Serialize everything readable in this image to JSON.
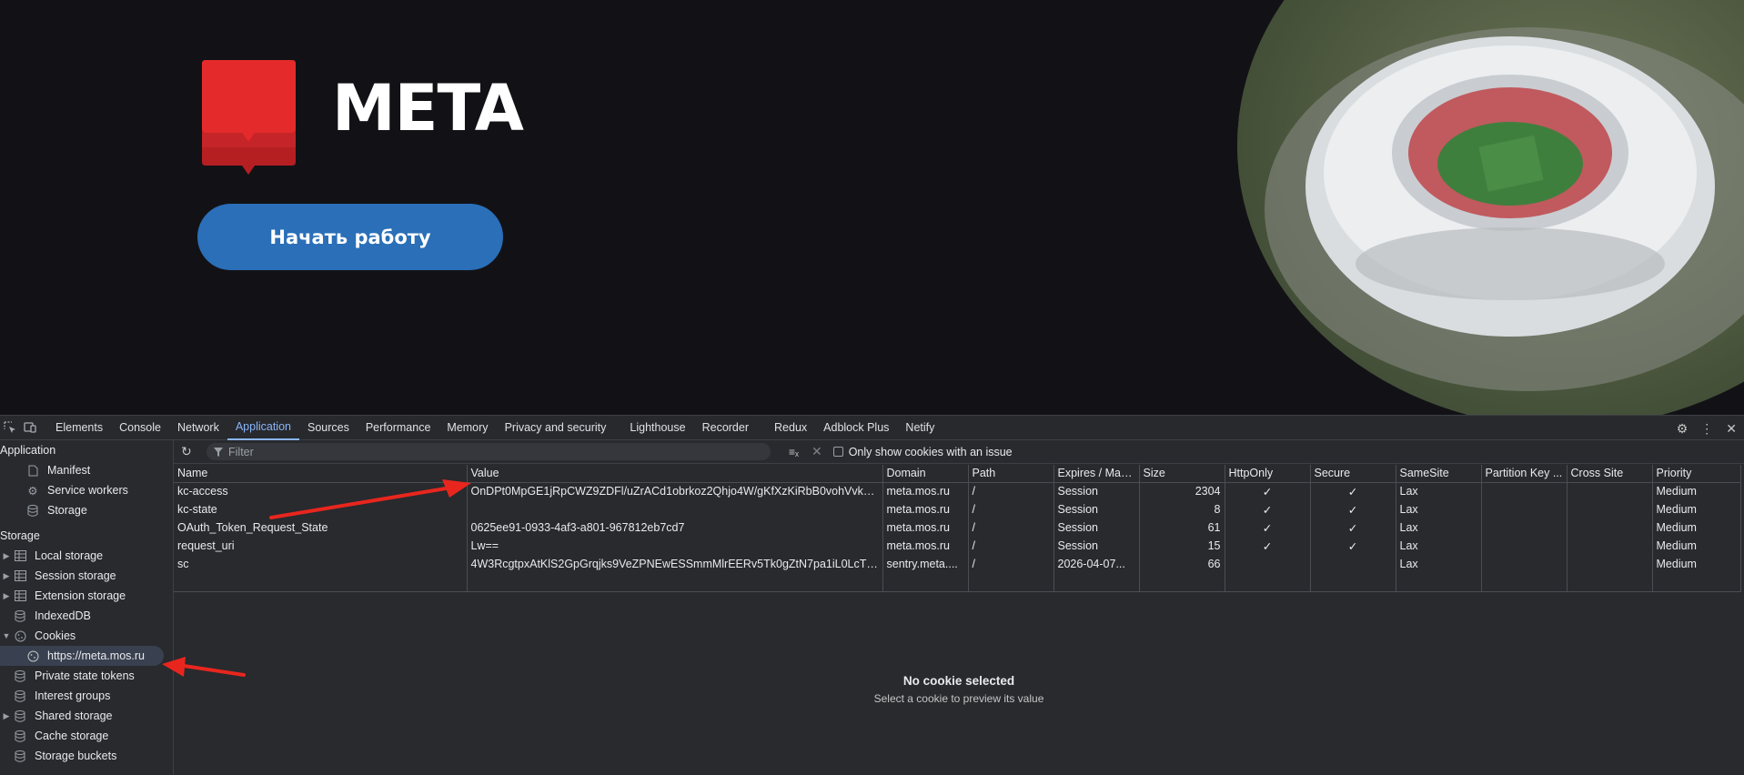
{
  "page": {
    "logo_text": "META",
    "start_button": "Начать работу",
    "brand_red": "#e42a2a",
    "button_blue": "#2a6fb8"
  },
  "devtools": {
    "tabs": [
      "Elements",
      "Console",
      "Network",
      "Application",
      "Sources",
      "Performance",
      "Memory",
      "Privacy and security",
      "Lighthouse",
      "Recorder",
      "Redux",
      "Adblock Plus",
      "Netify"
    ],
    "active_tab": "Application",
    "sidebar": {
      "application_title": "Application",
      "application_items": [
        "Manifest",
        "Service workers",
        "Storage"
      ],
      "storage_title": "Storage",
      "storage_items": [
        "Local storage",
        "Session storage",
        "Extension storage",
        "IndexedDB",
        "Cookies"
      ],
      "cookie_origin": "https://meta.mos.ru",
      "more_items": [
        "Private state tokens",
        "Interest groups",
        "Shared storage",
        "Cache storage",
        "Storage buckets"
      ]
    },
    "toolbar": {
      "filter_placeholder": "Filter",
      "only_issues_label": "Only show cookies with an issue"
    },
    "columns": [
      "Name",
      "Value",
      "Domain",
      "Path",
      "Expires / Max...",
      "Size",
      "HttpOnly",
      "Secure",
      "SameSite",
      "Partition Key ...",
      "Cross Site",
      "Priority"
    ],
    "rows": [
      [
        "kc-access",
        "OnDPt0MpGE1jRpCWZ9ZDFl/uZrACd1obrkoz2Qhjo4W/gKfXzKiRbB0vohVvkW...",
        "meta.mos.ru",
        "/",
        "Session",
        "2304",
        "✓",
        "✓",
        "Lax",
        "",
        "",
        "Medium"
      ],
      [
        "kc-state",
        "",
        "meta.mos.ru",
        "/",
        "Session",
        "8",
        "✓",
        "✓",
        "Lax",
        "",
        "",
        "Medium"
      ],
      [
        "OAuth_Token_Request_State",
        "0625ee91-0933-4af3-a801-967812eb7cd7",
        "meta.mos.ru",
        "/",
        "Session",
        "61",
        "✓",
        "✓",
        "Lax",
        "",
        "",
        "Medium"
      ],
      [
        "request_uri",
        "Lw==",
        "meta.mos.ru",
        "/",
        "Session",
        "15",
        "✓",
        "✓",
        "Lax",
        "",
        "",
        "Medium"
      ],
      [
        "sc",
        "4W3RcgtpxAtKlS2GpGrqjks9VeZPNEwESSmmMlrEERv5Tk0gZtN7pa1iL0LcTZ...",
        "sentry.meta....",
        "/",
        "2026-04-07...",
        "66",
        "",
        "",
        "Lax",
        "",
        "",
        "Medium"
      ]
    ],
    "preview": {
      "title": "No cookie selected",
      "subtitle": "Select a cookie to preview its value"
    },
    "accent": "#8ab4f8"
  }
}
